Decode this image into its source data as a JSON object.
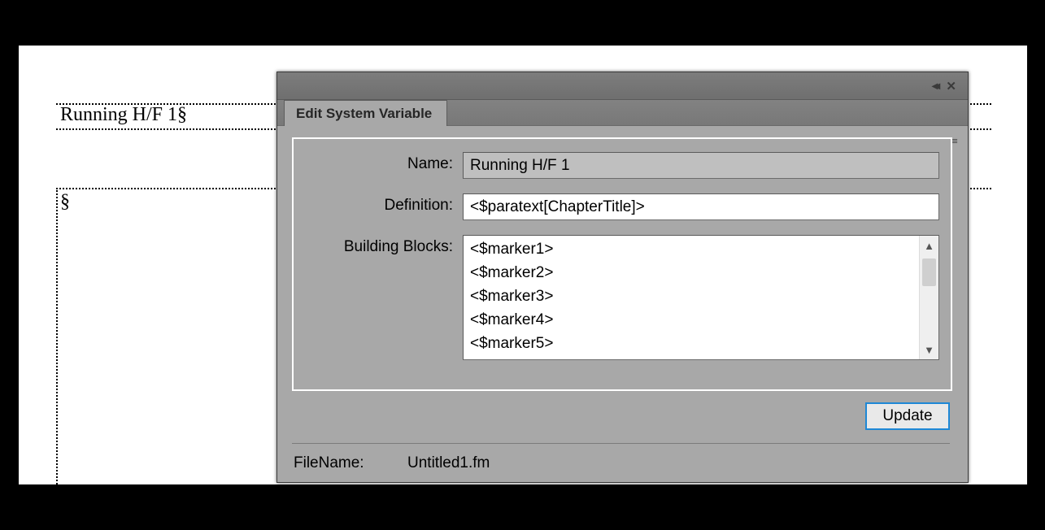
{
  "document": {
    "header_text": "Running H/F 1§",
    "section_marker": "§"
  },
  "dialog": {
    "tab_title": "Edit System Variable",
    "labels": {
      "name": "Name:",
      "definition": "Definition:",
      "building_blocks": "Building Blocks:"
    },
    "fields": {
      "name_value": "Running H/F 1",
      "definition_value": "<$paratext[ChapterTitle]>"
    },
    "building_blocks": [
      "<$marker1>",
      "<$marker2>",
      "<$marker3>",
      "<$marker4>",
      "<$marker5>"
    ],
    "update_button": "Update",
    "footer": {
      "filename_label": "FileName:",
      "filename_value": "Untitled1.fm"
    }
  }
}
